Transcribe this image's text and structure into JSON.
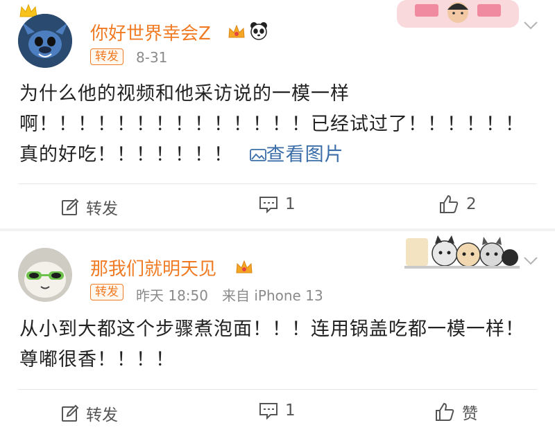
{
  "comments": [
    {
      "user": "你好世界幸会Z",
      "tag": "转发",
      "date": "8-31",
      "text": "为什么他的视频和他采访说的一模一样啊！！！！！！！！！！！！！！已经试过了！！！！！！真的好吃！！！！！！！",
      "image_link": "查看图片",
      "actions": {
        "repost": "转发",
        "comments": "1",
        "likes": "2"
      }
    },
    {
      "user": "那我们就明天见",
      "tag": "转发",
      "date": "昨天 18:50",
      "source": "来自 iPhone 13",
      "text": "从小到大都这个步骤煮泡面！！！连用锅盖吃都一模一样！尊嘟很香！！！！",
      "actions": {
        "repost": "转发",
        "comments": "1",
        "likes": "赞"
      }
    }
  ],
  "colors": {
    "name": "#f07b24",
    "link": "#3b6ea8",
    "meta": "#8a8a8a"
  }
}
